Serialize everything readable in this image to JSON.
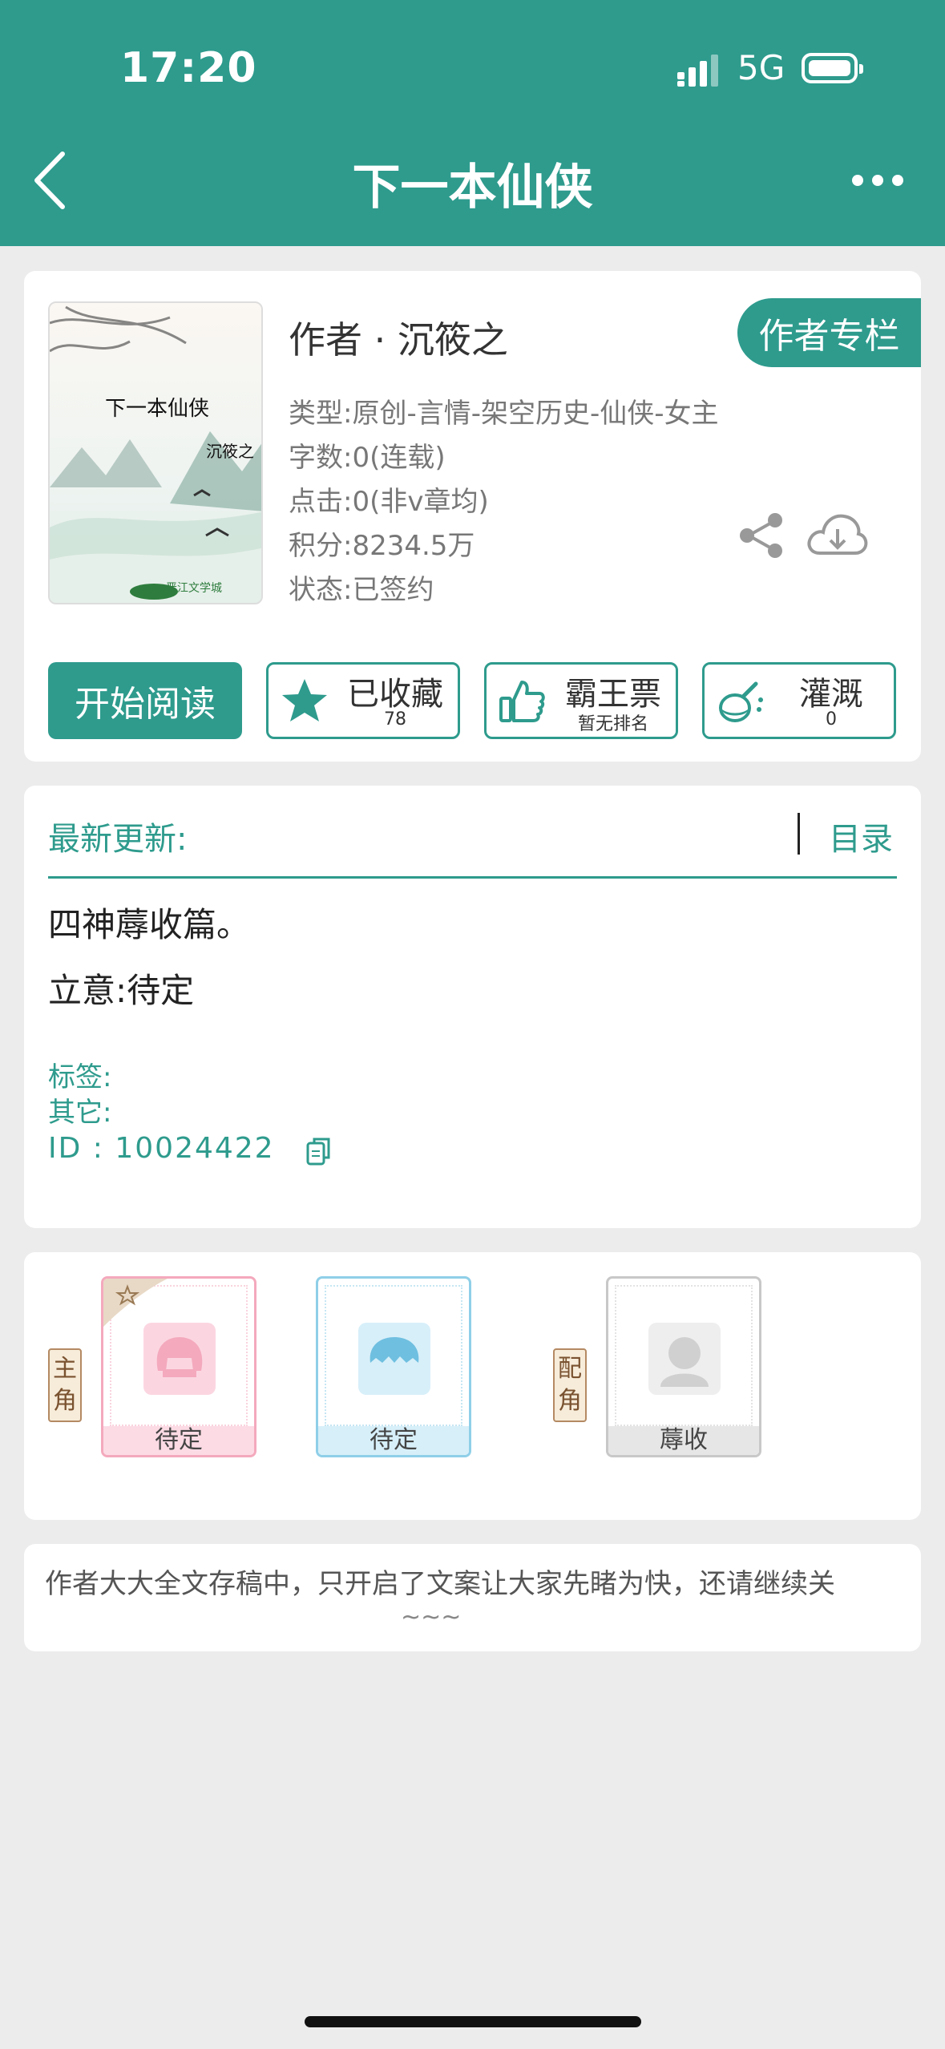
{
  "status_bar": {
    "time": "17:20",
    "network": "5G"
  },
  "nav": {
    "title": "下一本仙侠"
  },
  "book": {
    "cover_title": "下一本仙侠",
    "cover_author": "沉筱之",
    "cover_logo": "晋江文学城",
    "author": "作者 · 沉筱之",
    "column_button": "作者专栏",
    "info": [
      "类型:原创-言情-架空历史-仙侠-女主",
      "字数:0(连载)",
      "点击:0(非v章均)",
      "积分:8234.5万",
      "状态:已签约"
    ]
  },
  "actions": {
    "read": "开始阅读",
    "collect": {
      "label": "已收藏",
      "sub": "78"
    },
    "ticket": {
      "label": "霸王票",
      "sub": "暂无排名"
    },
    "water": {
      "label": "灌溉",
      "sub": "0"
    }
  },
  "latest": {
    "label": "最新更新:",
    "toc": "目录",
    "intro_line1": "四神蓐收篇。",
    "intro_line2": "立意:待定",
    "tags_label": "标签:",
    "other_label": "其它:",
    "id_text": "ID  :  10024422"
  },
  "characters": {
    "main_tag": [
      "主",
      "角"
    ],
    "support_tag": [
      "配",
      "角"
    ],
    "items": [
      {
        "name": "待定",
        "color": "#f4a9bd",
        "role": "main"
      },
      {
        "name": "待定",
        "color": "#8fcfe8",
        "role": "main"
      },
      {
        "name": "蓐收",
        "color": "#c8c8c8",
        "role": "support"
      }
    ]
  },
  "note": {
    "text": "作者大大全文存稿中，只开启了文案让大家先睹为快，还请继续关",
    "tail": "~~~"
  }
}
